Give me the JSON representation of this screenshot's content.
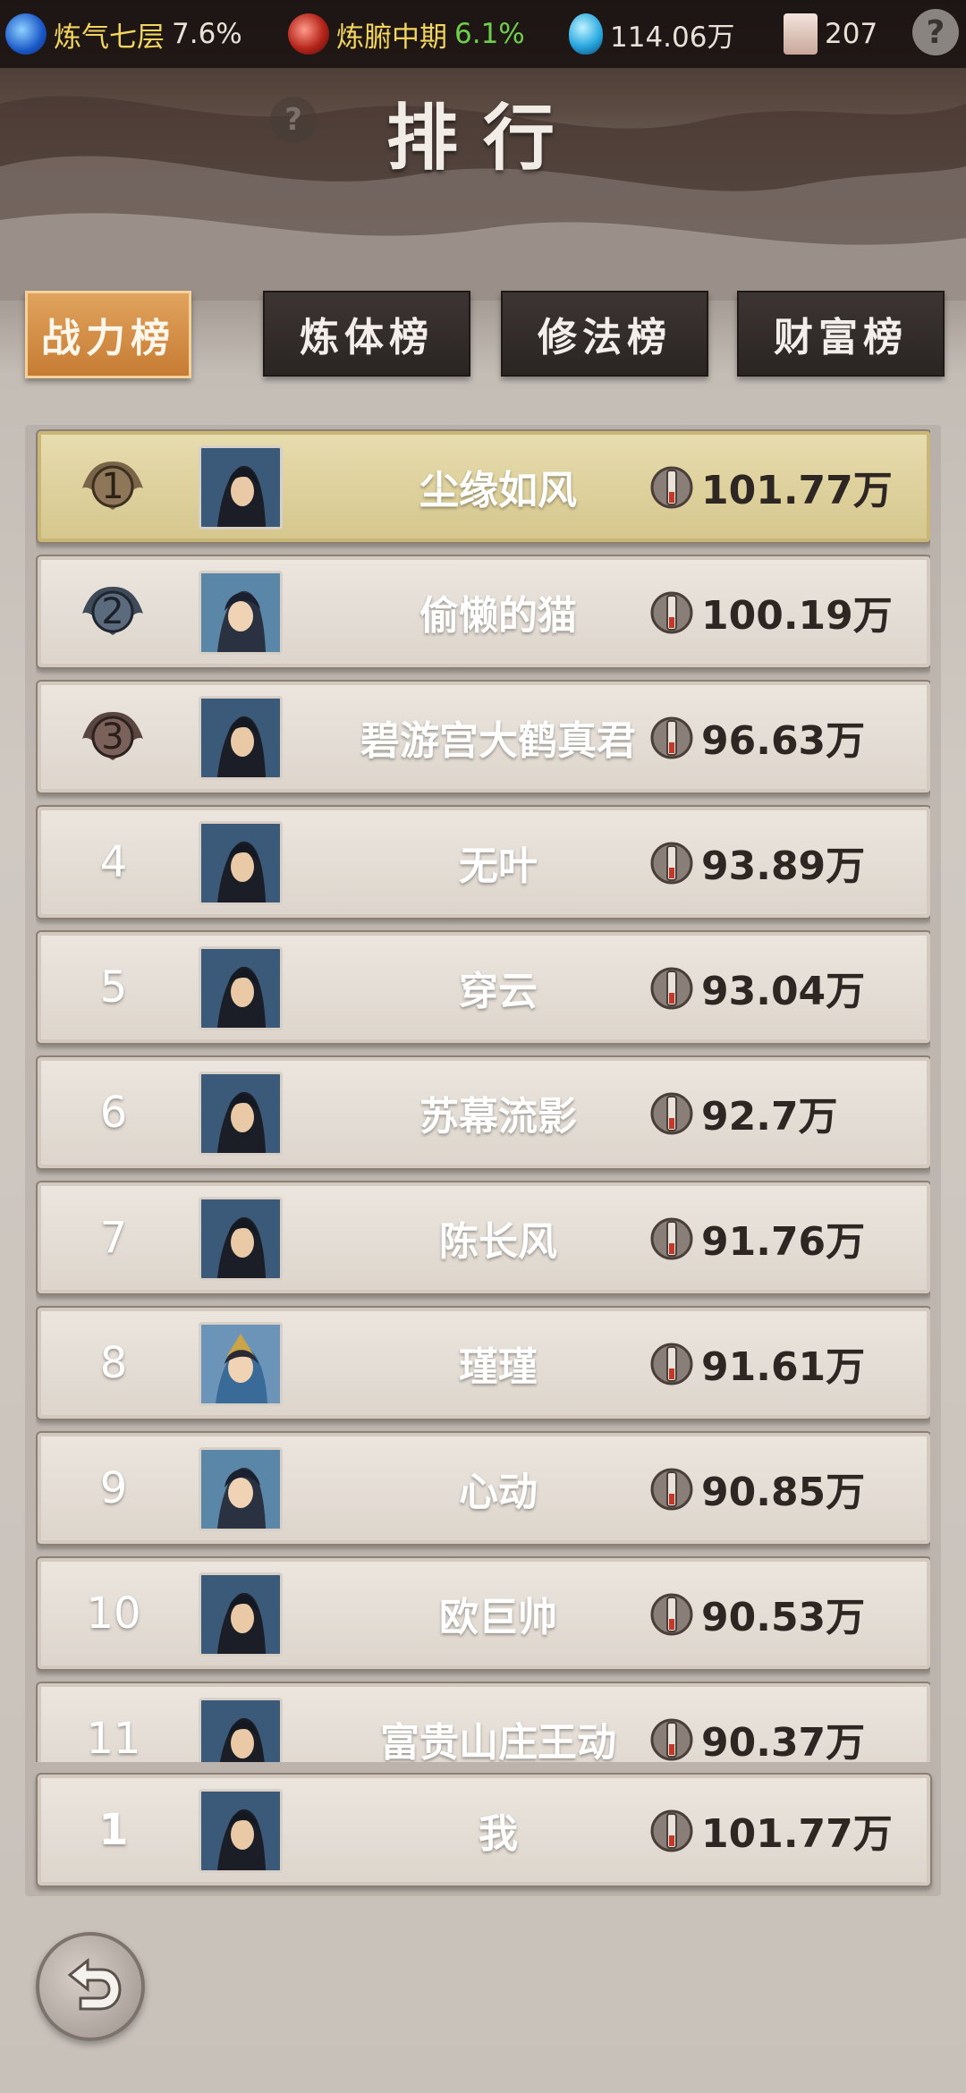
{
  "top_bar": {
    "cultivation": {
      "name": "炼气七层",
      "percent": "7.6%"
    },
    "body_refine": {
      "name": "炼腑中期",
      "percent": "6.1%"
    },
    "spirit_stones": "114.06万",
    "tokens": "207",
    "help": "?"
  },
  "header": {
    "title": "排行",
    "help": "?"
  },
  "tabs": [
    {
      "label": "战力榜",
      "active": true
    },
    {
      "label": "炼体榜",
      "active": false
    },
    {
      "label": "修法榜",
      "active": false
    },
    {
      "label": "财富榜",
      "active": false
    }
  ],
  "rankings": [
    {
      "rank": "1",
      "name": "尘缘如风",
      "power": "101.77万"
    },
    {
      "rank": "2",
      "name": "偷懒的猫",
      "power": "100.19万"
    },
    {
      "rank": "3",
      "name": "碧游宫大鹤真君",
      "power": "96.63万"
    },
    {
      "rank": "4",
      "name": "无叶",
      "power": "93.89万"
    },
    {
      "rank": "5",
      "name": "穿云",
      "power": "93.04万"
    },
    {
      "rank": "6",
      "name": "苏幕流影",
      "power": "92.7万"
    },
    {
      "rank": "7",
      "name": "陈长风",
      "power": "91.76万"
    },
    {
      "rank": "8",
      "name": "瑾瑾",
      "power": "91.61万"
    },
    {
      "rank": "9",
      "name": "心动",
      "power": "90.85万"
    },
    {
      "rank": "10",
      "name": "欧巨帅",
      "power": "90.53万"
    },
    {
      "rank": "11",
      "name": "富贵山庄王动",
      "power": "90.37万"
    }
  ],
  "my_rank": {
    "rank": "1",
    "name": "我",
    "power": "101.77万"
  },
  "colors": {
    "accent_tab": "#d28d44",
    "gold_row": "#e1d49f",
    "row_bg": "#e4ddd5"
  }
}
